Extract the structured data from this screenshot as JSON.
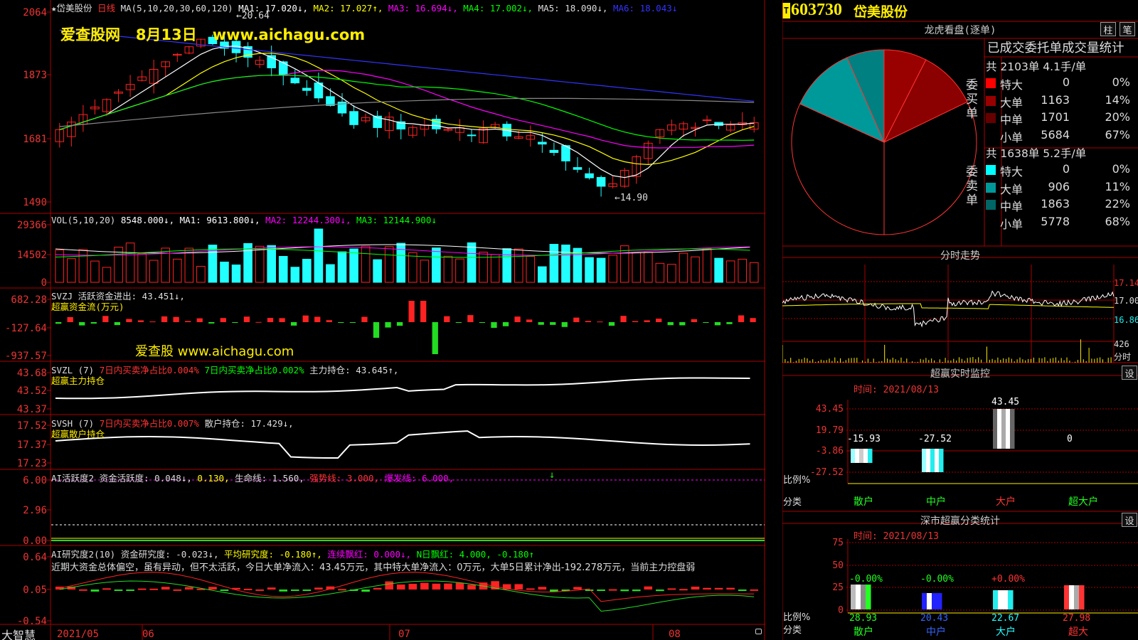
{
  "colors": {
    "up": "#ff2222",
    "down": "#22ffff",
    "grid": "#aa0000",
    "ma1": "#ffffff",
    "ma2": "#ffff00",
    "ma3": "#ff00ff",
    "ma4": "#00ff00",
    "ma5": "#3333ff",
    "ma6": "#888888",
    "yellow": "#ffee00"
  },
  "watermark": {
    "top": "爱查股网   8月13日   www.aichagu.com",
    "mid": "爱查股 www.aichagu.com"
  },
  "panels": {
    "price": {
      "header": [
        {
          "t": "★岱美股份",
          "c": "#dddddd"
        },
        {
          "t": "日线",
          "c": "#ff3333"
        },
        {
          "t": "MA(5,10,20,30,60,120)",
          "c": "#dddddd"
        },
        {
          "t": "MA1: 17.020↓,",
          "c": "#ffffff"
        },
        {
          "t": "MA2: 17.027↑,",
          "c": "#ffff00"
        },
        {
          "t": "MA3: 16.694↓,",
          "c": "#ff00ff"
        },
        {
          "t": "MA4: 17.002↓,",
          "c": "#00ff00"
        },
        {
          "t": "MA5: 18.090↓,",
          "c": "#dddddd"
        },
        {
          "t": "MA6: 18.043↓",
          "c": "#3333ff"
        }
      ],
      "axis": [
        "2064",
        "1873",
        "1681",
        "1490"
      ],
      "high_label": "←20.64",
      "low_label": "←14.90"
    },
    "vol": {
      "header": [
        {
          "t": "VOL(5,10,20)",
          "c": "#dddddd"
        },
        {
          "t": "8548.000↓,",
          "c": "#ffffff"
        },
        {
          "t": "MA1: 9613.800↓,",
          "c": "#ffffff"
        },
        {
          "t": "MA2: 12244.300↓,",
          "c": "#ff00ff"
        },
        {
          "t": "MA3: 12144.900↓",
          "c": "#00ff00"
        }
      ],
      "axis": [
        "29366",
        "14502",
        "0"
      ]
    },
    "svzj": {
      "header": [
        {
          "t": "SVZJ  活跃资金进出: 43.451↓,",
          "c": "#dddddd"
        }
      ],
      "sub": "超赢资金流(万元)",
      "axis": [
        "682.28",
        "-127.64",
        "-937.57"
      ]
    },
    "svzl": {
      "header": [
        {
          "t": "SVZL (7)",
          "c": "#dddddd"
        },
        {
          "t": "7日内买卖净占比0.004%",
          "c": "#ff3333"
        },
        {
          "t": "7日内买卖净占比0.002%",
          "c": "#00ff00"
        },
        {
          "t": "主力持仓: 43.645↑,",
          "c": "#dddddd"
        }
      ],
      "sub": "超赢主力持仓",
      "axis": [
        "43.68",
        "43.52",
        "43.37"
      ]
    },
    "svsh": {
      "header": [
        {
          "t": "SVSH (7)",
          "c": "#dddddd"
        },
        {
          "t": "7日内买卖净占比0.007%",
          "c": "#ff3333"
        },
        {
          "t": "散户持仓: 17.429↓,",
          "c": "#dddddd"
        }
      ],
      "sub": "超赢散户持仓",
      "axis": [
        "17.52",
        "17.37",
        "17.23"
      ]
    },
    "ai1": {
      "header": [
        {
          "t": "AI活跃度2",
          "c": "#dddddd"
        },
        {
          "t": "资金活跃度: 0.048↓,",
          "c": "#dddddd"
        },
        {
          "t": "0.130,",
          "c": "#ffff00"
        },
        {
          "t": "生命线: 1.560,",
          "c": "#dddddd"
        },
        {
          "t": "强势线: 3.000,",
          "c": "#ff3333"
        },
        {
          "t": "爆发线: 6.000,",
          "c": "#ff00ff"
        }
      ],
      "axis": [
        "6.00",
        "2.96",
        "0.00"
      ]
    },
    "ai2": {
      "header": [
        {
          "t": "AI研究度2(10)",
          "c": "#dddddd"
        },
        {
          "t": "资金研究度: -0.023↓,",
          "c": "#dddddd"
        },
        {
          "t": "平均研究度: -0.180↑,",
          "c": "#ffff00"
        },
        {
          "t": "连续飘红: 0.000↓,",
          "c": "#ff00ff"
        },
        {
          "t": "N日飘红: 4.000, -0.180↑",
          "c": "#00ff00"
        }
      ],
      "comment": "近期大资金总体偏空，虽有异动，但不太活跃，今日大单净流入：43.45万元，其中特大单净流入：0万元，大单5日累计净出-192.278万元，当前主力控盘弱",
      "axis": [
        "0.64",
        "0.05",
        "-0.54"
      ]
    }
  },
  "footer": {
    "brand": "大智慧",
    "dates": [
      "2021/05",
      "06",
      "07",
      "08"
    ]
  },
  "stock": {
    "badge": "T",
    "code": "603730",
    "name": "岱美股份"
  },
  "longhu": {
    "title": "龙虎看盘(逐单)",
    "btn1": "柱",
    "btn2": "笔",
    "table_title": "已成交委托单成交量统计",
    "buy": {
      "side": "委买单",
      "summary": "共 2103单 4.1手/单",
      "rows": [
        {
          "label": "特大",
          "count": "0",
          "pct": "0%",
          "c": "#ff0000"
        },
        {
          "label": "大单",
          "count": "1163",
          "pct": "14%",
          "c": "#990000"
        },
        {
          "label": "中单",
          "count": "1701",
          "pct": "20%",
          "c": "#660000"
        },
        {
          "label": "小单",
          "count": "5684",
          "pct": "67%",
          "c": "#000000"
        }
      ]
    },
    "sell": {
      "side": "委卖单",
      "summary": "共 1638单 5.2手/单",
      "rows": [
        {
          "label": "特大",
          "count": "0",
          "pct": "0%",
          "c": "#00ffff"
        },
        {
          "label": "大单",
          "count": "906",
          "pct": "11%",
          "c": "#009999"
        },
        {
          "label": "中单",
          "count": "1863",
          "pct": "22%",
          "c": "#006666"
        },
        {
          "label": "小单",
          "count": "5778",
          "pct": "68%",
          "c": "#000000"
        }
      ]
    }
  },
  "intraday": {
    "title": "分时走势",
    "prices": [
      "17.14",
      "17.00",
      "16.86"
    ],
    "vol_label": "426",
    "vol_unit": "分时"
  },
  "monitor": {
    "title": "超赢实时监控",
    "btn": "设",
    "time": "时间: 2021/08/13",
    "axis": [
      "43.45",
      "19.79",
      "-3.86",
      "-27.52"
    ],
    "bar_labels": [
      "-15.93",
      "-27.52",
      "43.45",
      "0"
    ],
    "ratio": "比例%",
    "cat": "分类",
    "cats": [
      "散户",
      "中户",
      "大户",
      "超大户"
    ]
  },
  "sz": {
    "title": "深市超赢分类统计",
    "btn": "设",
    "time": "时间: 2021/08/13",
    "axis": [
      "75",
      "50",
      "25",
      "0"
    ],
    "top_labels": [
      "-0.00%",
      "-0.00%",
      "+0.00%",
      ""
    ],
    "values": [
      "28.93",
      "20.43",
      "22.67",
      "27.98"
    ],
    "ratio": "比例%",
    "cat": "分类",
    "cats": [
      "散户",
      "中户",
      "大户",
      "超大"
    ]
  }
}
